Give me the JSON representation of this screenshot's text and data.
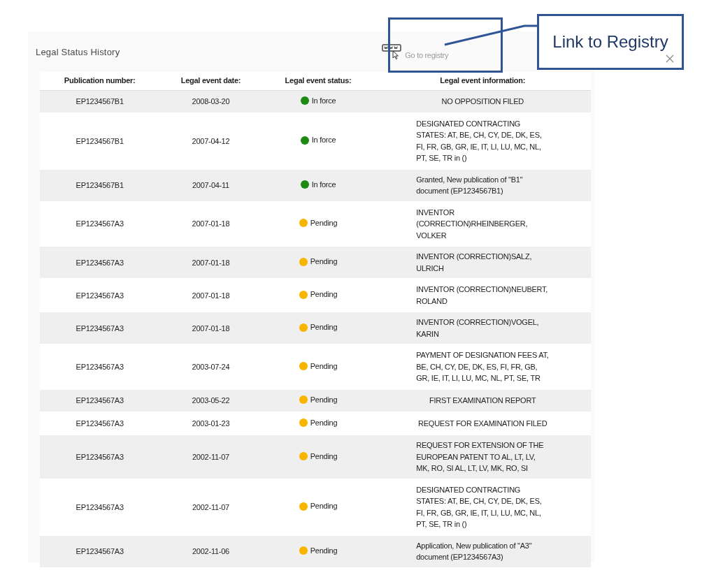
{
  "panel": {
    "title": "Legal Status History",
    "registry_link": "Go to registry"
  },
  "callout": {
    "text": "Link to Registry"
  },
  "table": {
    "columns": [
      "Publication number:",
      "Legal event date:",
      "Legal event status:",
      "Legal event information:"
    ],
    "rows": [
      {
        "publication": "EP1234567B1",
        "date": "2008-03-20",
        "status": {
          "label": "In force",
          "color": "#1e8a12"
        },
        "info": "NO OPPOSITION FILED"
      },
      {
        "publication": "EP1234567B1",
        "date": "2007-04-12",
        "status": {
          "label": "In force",
          "color": "#1e8a12"
        },
        "info": "DESIGNATED CONTRACTING STATES: AT, BE, CH, CY, DE, DK, ES, FI, FR, GB, GR, IE, IT, LI, LU, MC, NL, PT, SE, TR in ()"
      },
      {
        "publication": "EP1234567B1",
        "date": "2007-04-11",
        "status": {
          "label": "In force",
          "color": "#1e8a12"
        },
        "info": "Granted, New publication of \"B1\" document (EP1234567B1)"
      },
      {
        "publication": "EP1234567A3",
        "date": "2007-01-18",
        "status": {
          "label": "Pending",
          "color": "#f7b500"
        },
        "info": "INVENTOR (CORRECTION)RHEINBERGER, VOLKER"
      },
      {
        "publication": "EP1234567A3",
        "date": "2007-01-18",
        "status": {
          "label": "Pending",
          "color": "#f7b500"
        },
        "info": "INVENTOR (CORRECTION)SALZ, ULRICH"
      },
      {
        "publication": "EP1234567A3",
        "date": "2007-01-18",
        "status": {
          "label": "Pending",
          "color": "#f7b500"
        },
        "info": "INVENTOR (CORRECTION)NEUBERT, ROLAND"
      },
      {
        "publication": "EP1234567A3",
        "date": "2007-01-18",
        "status": {
          "label": "Pending",
          "color": "#f7b500"
        },
        "info": "INVENTOR (CORRECTION)VOGEL, KARIN"
      },
      {
        "publication": "EP1234567A3",
        "date": "2003-07-24",
        "status": {
          "label": "Pending",
          "color": "#f7b500"
        },
        "info": "PAYMENT OF DESIGNATION FEES AT, BE, CH, CY, DE, DK, ES, FI, FR, GB, GR, IE, IT, LI, LU, MC, NL, PT, SE, TR"
      },
      {
        "publication": "EP1234567A3",
        "date": "2003-05-22",
        "status": {
          "label": "Pending",
          "color": "#f7b500"
        },
        "info": "FIRST EXAMINATION REPORT"
      },
      {
        "publication": "EP1234567A3",
        "date": "2003-01-23",
        "status": {
          "label": "Pending",
          "color": "#f7b500"
        },
        "info": "REQUEST FOR EXAMINATION FILED"
      },
      {
        "publication": "EP1234567A3",
        "date": "2002-11-07",
        "status": {
          "label": "Pending",
          "color": "#f7b500"
        },
        "info": "REQUEST FOR EXTENSION OF THE EUROPEAN PATENT TO AL, LT, LV, MK, RO, SI AL, LT, LV, MK, RO, SI"
      },
      {
        "publication": "EP1234567A3",
        "date": "2002-11-07",
        "status": {
          "label": "Pending",
          "color": "#f7b500"
        },
        "info": "DESIGNATED CONTRACTING STATES: AT, BE, CH, CY, DE, DK, ES, FI, FR, GB, GR, IE, IT, LI, LU, MC, NL, PT, SE, TR in ()"
      },
      {
        "publication": "EP1234567A3",
        "date": "2002-11-06",
        "status": {
          "label": "Pending",
          "color": "#f7b500"
        },
        "info": "Application, New publication of \"A3\" document (EP1234567A3)"
      }
    ]
  }
}
